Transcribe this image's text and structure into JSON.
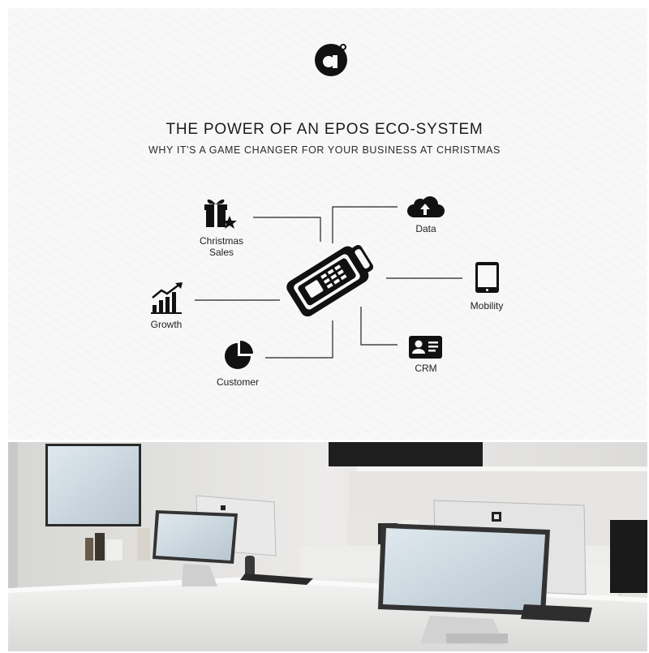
{
  "title": "THE POWER OF AN EPOS ECO-SYSTEM",
  "subtitle": "WHY IT'S A GAME CHANGER FOR YOUR BUSINESS AT CHRISTMAS",
  "nodes": {
    "christmas_sales": {
      "label": "Christmas\nSales",
      "icon": "gift-star-icon"
    },
    "data": {
      "label": "Data",
      "icon": "cloud-upload-icon"
    },
    "mobility": {
      "label": "Mobility",
      "icon": "tablet-icon"
    },
    "growth": {
      "label": "Growth",
      "icon": "growth-chart-icon"
    },
    "customer": {
      "label": "Customer",
      "icon": "pie-chart-icon"
    },
    "crm": {
      "label": "CRM",
      "icon": "contact-card-icon"
    }
  },
  "center": {
    "icon": "card-terminal-icon"
  },
  "colors": {
    "ink": "#111111",
    "panel": "#f8f8f8",
    "line": "#222222"
  }
}
